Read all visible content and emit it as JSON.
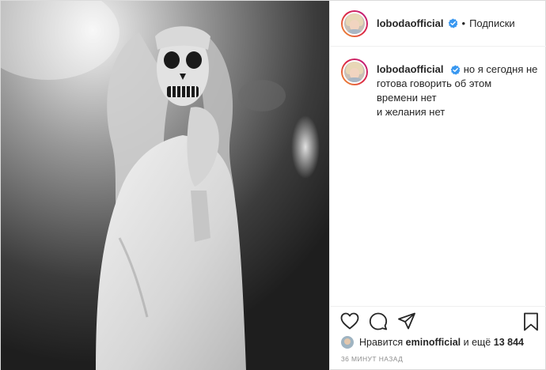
{
  "post": {
    "author": {
      "username": "lobodaofficial",
      "verified": true,
      "verified_icon": "verified-badge-icon",
      "follow_status": "Подписки",
      "separator": "•"
    },
    "caption": {
      "username": "lobodaofficial",
      "lines": [
        "но я сегодня не",
        "готова говорить об этом",
        "времени нет",
        "и желания нет"
      ]
    },
    "actions": {
      "like_icon": "heart-icon",
      "comment_icon": "comment-icon",
      "share_icon": "share-icon",
      "save_icon": "bookmark-icon"
    },
    "likes": {
      "prefix": "Нравится",
      "user": "eminofficial",
      "middle": "и ещё",
      "count": "13 844"
    },
    "time": "36 минут назад",
    "colors": {
      "accent_blue": "#3897f0",
      "text": "#262626",
      "muted": "#8e8e8e",
      "border": "#efefef"
    }
  }
}
